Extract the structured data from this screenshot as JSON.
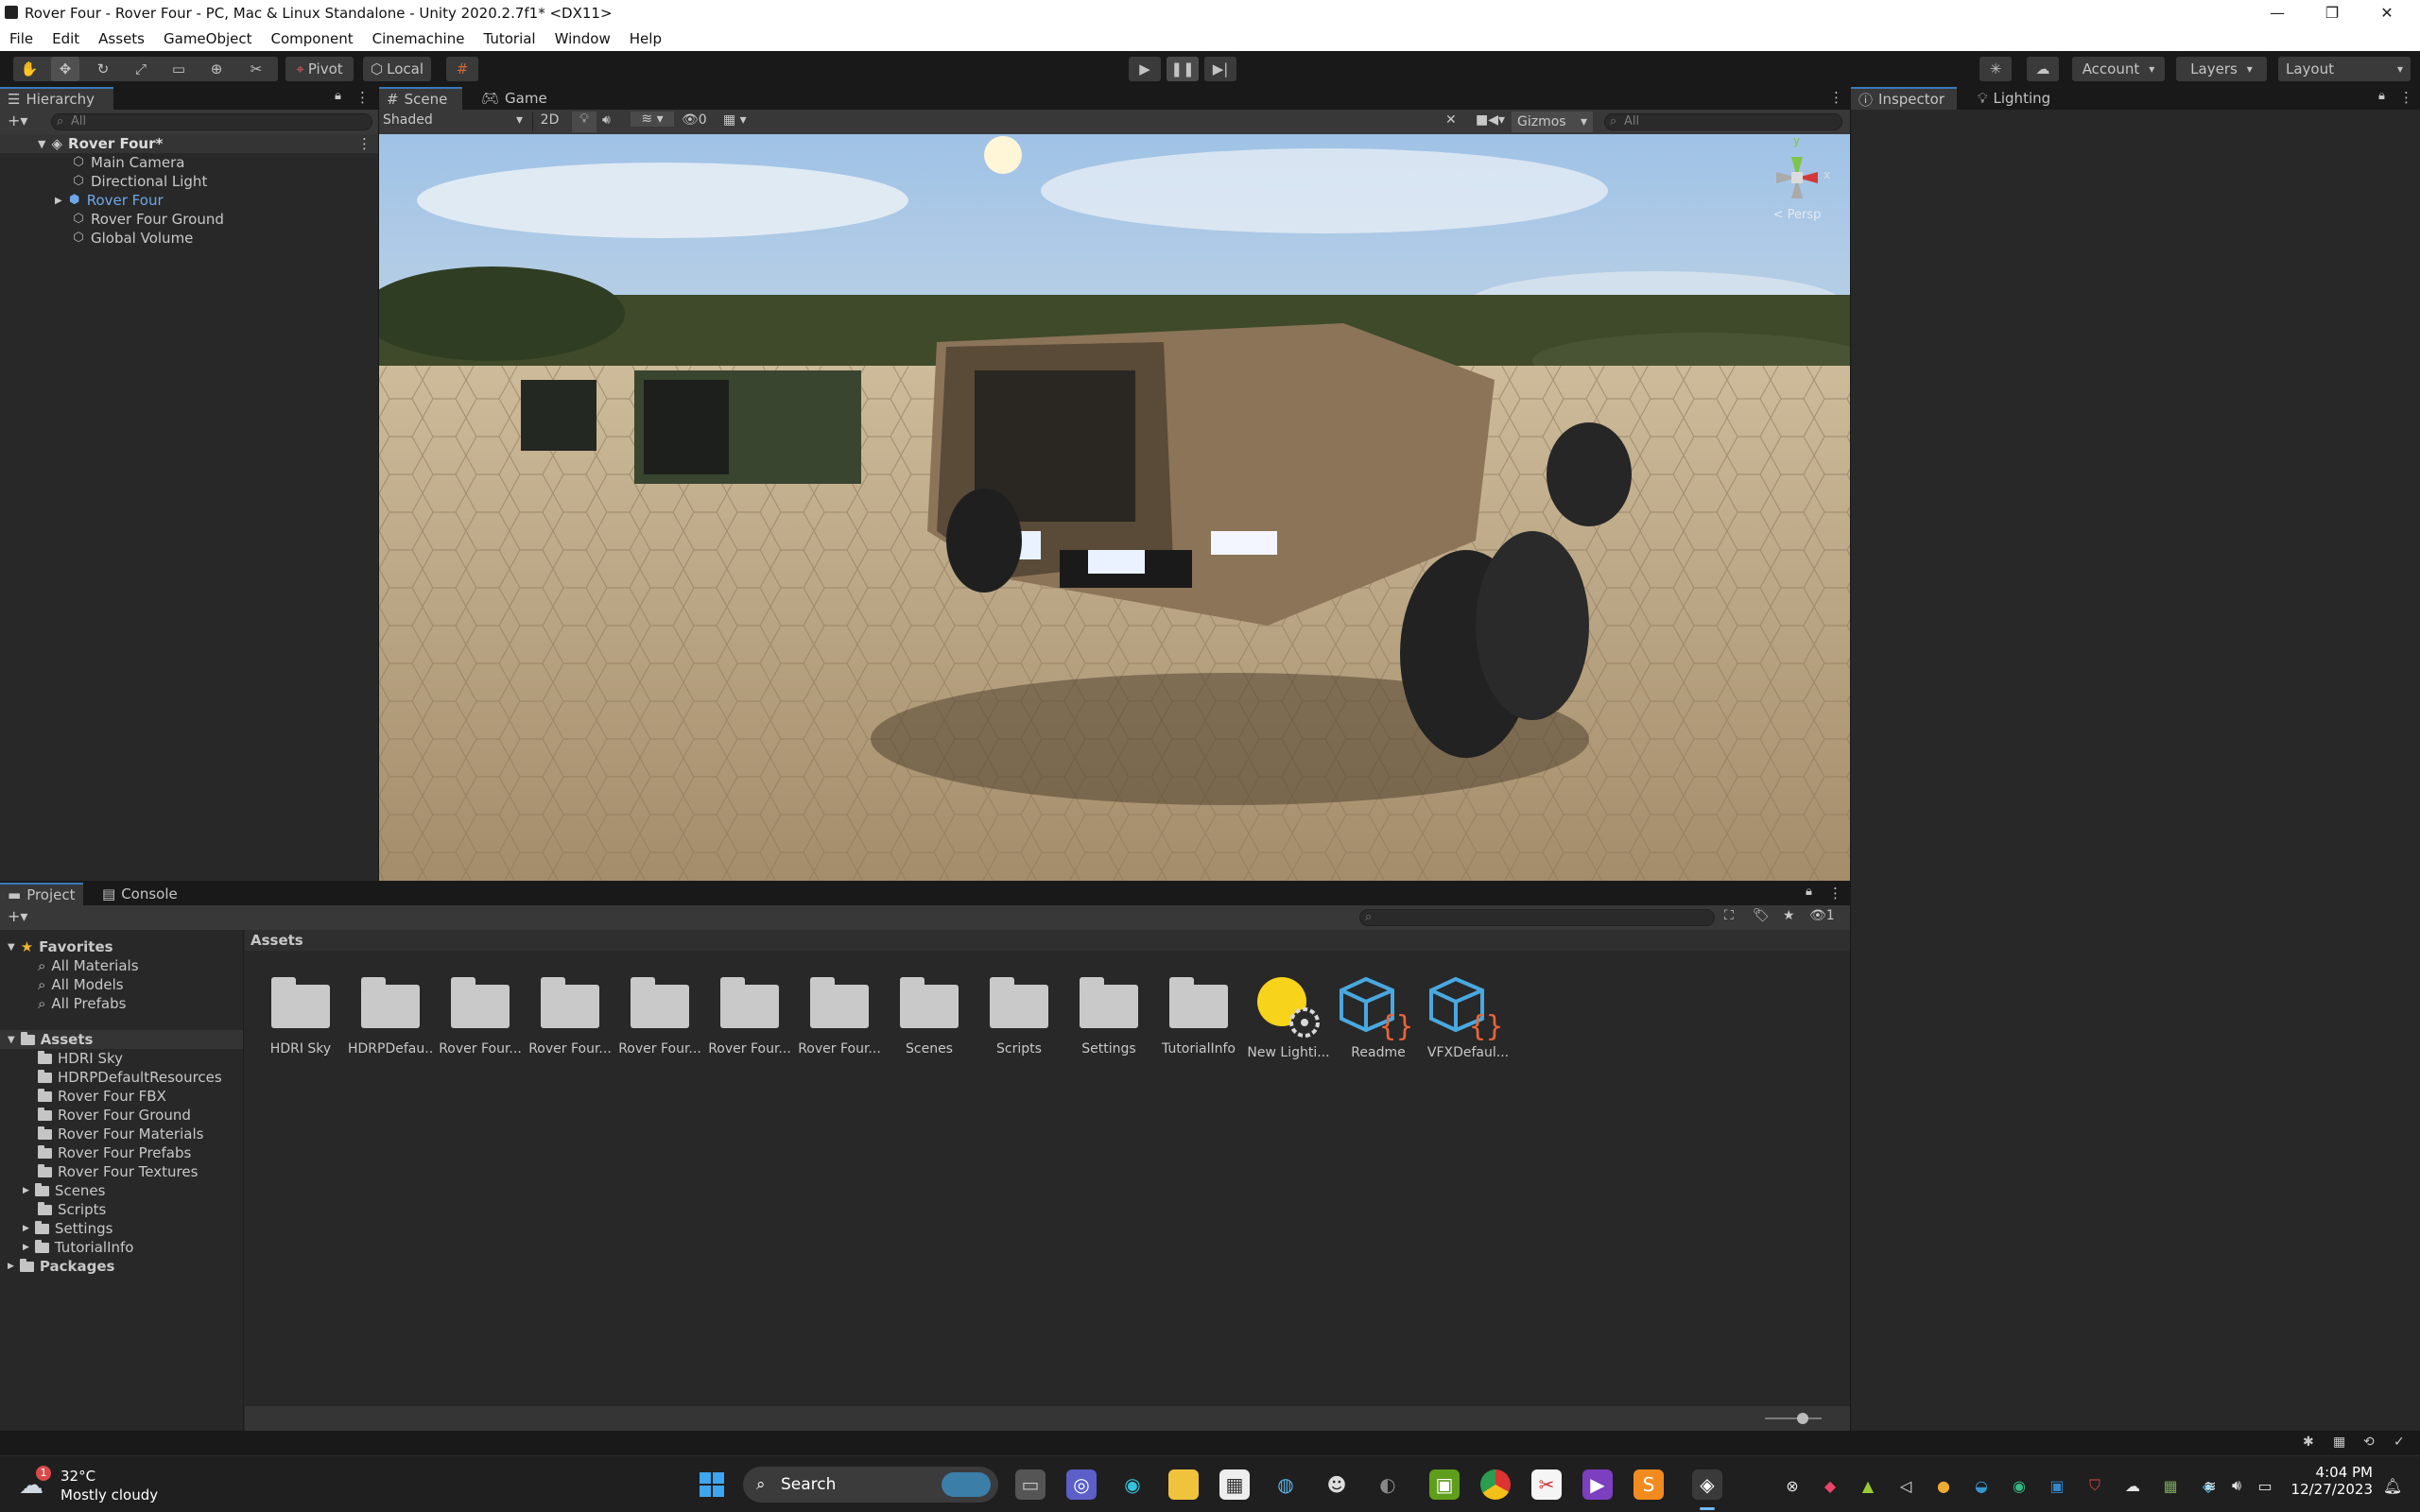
{
  "window": {
    "title": "Rover Four - Rover Four - PC, Mac & Linux Standalone - Unity 2020.2.7f1* <DX11>"
  },
  "menu": [
    "File",
    "Edit",
    "Assets",
    "GameObject",
    "Component",
    "Cinemachine",
    "Tutorial",
    "Window",
    "Help"
  ],
  "toolbar": {
    "pivot": "Pivot",
    "local": "Local",
    "account": "Account",
    "layers": "Layers",
    "layout": "Layout"
  },
  "hierarchy": {
    "tab": "Hierarchy",
    "search_placeholder": "All",
    "root": "Rover Four*",
    "items": [
      "Main Camera",
      "Directional Light",
      "Rover Four",
      "Rover Four Ground",
      "Global Volume"
    ]
  },
  "scene": {
    "tabs": [
      "Scene",
      "Game"
    ],
    "shading": "Shaded",
    "mode_2d": "2D",
    "hidden_count": "0",
    "gizmos": "Gizmos",
    "search_placeholder": "All",
    "persp": "< Persp",
    "axis_y": "y",
    "axis_x": "x"
  },
  "inspector": {
    "tabs": [
      "Inspector",
      "Lighting"
    ]
  },
  "project": {
    "tabs": [
      "Project",
      "Console"
    ],
    "breadcrumb": "Assets",
    "hidden_count": "1",
    "favorites_label": "Favorites",
    "favorites": [
      "All Materials",
      "All Models",
      "All Prefabs"
    ],
    "assets_label": "Assets",
    "assets_tree": [
      "HDRI Sky",
      "HDRPDefaultResources",
      "Rover Four FBX",
      "Rover Four Ground",
      "Rover Four Materials",
      "Rover Four Prefabs",
      "Rover Four Textures",
      "Scenes",
      "Scripts",
      "Settings",
      "TutorialInfo"
    ],
    "packages_label": "Packages",
    "grid": [
      "HDRI Sky",
      "HDRPDefau...",
      "Rover Four...",
      "Rover Four...",
      "Rover Four...",
      "Rover Four...",
      "Rover Four...",
      "Scenes",
      "Scripts",
      "Settings",
      "TutorialInfo",
      "New Lighti...",
      "Readme",
      "VFXDefaul..."
    ]
  },
  "taskbar": {
    "weather_temp": "32°C",
    "weather_desc": "Mostly cloudy",
    "weather_badge": "1",
    "search": "Search",
    "time": "4:04 PM",
    "date": "12/27/2023"
  },
  "colors": {
    "accent": "#3a79bb",
    "selected_text": "#6ea7e8",
    "panel": "#282828",
    "dark": "#191919"
  }
}
